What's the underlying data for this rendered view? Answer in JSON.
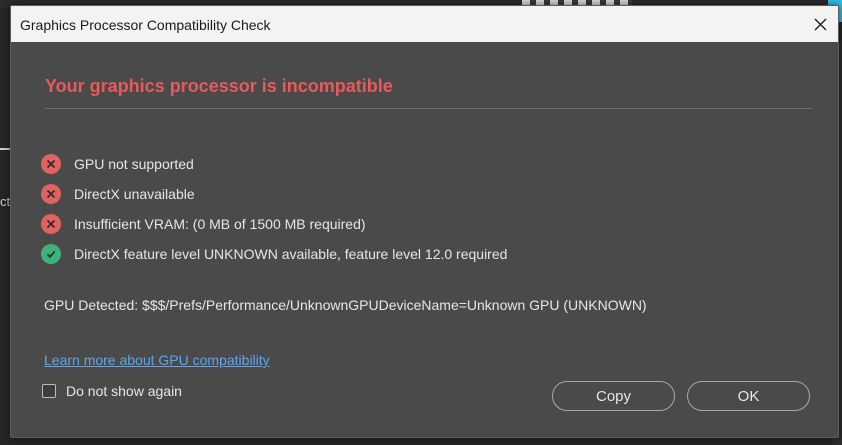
{
  "window": {
    "title": "Graphics Processor Compatibility Check"
  },
  "background": {
    "partial_text": "ct"
  },
  "heading": "Your graphics processor is incompatible",
  "checks": [
    {
      "status": "fail",
      "icon": "x-circle-icon",
      "text": "GPU not supported"
    },
    {
      "status": "fail",
      "icon": "x-circle-icon",
      "text": "DirectX unavailable"
    },
    {
      "status": "fail",
      "icon": "x-circle-icon",
      "text": "Insufficient VRAM: (0 MB of 1500 MB required)"
    },
    {
      "status": "pass",
      "icon": "check-circle-icon",
      "text": "DirectX feature level UNKNOWN available, feature level 12.0 required"
    }
  ],
  "gpu_detected": "GPU Detected: $$$/Prefs/Performance/UnknownGPUDeviceName=Unknown GPU (UNKNOWN)",
  "learn_more_link": "Learn more about GPU compatibility",
  "dont_show_again": {
    "label": "Do not show again",
    "checked": false
  },
  "buttons": {
    "copy_label": "Copy",
    "ok_label": "OK"
  },
  "colors": {
    "heading": "#e85a5a",
    "fail": "#e06262",
    "pass": "#3fb27c",
    "link": "#5aa6f2",
    "dialog_bg": "#4a4a4a",
    "titlebar_bg": "#f3f3f3"
  }
}
